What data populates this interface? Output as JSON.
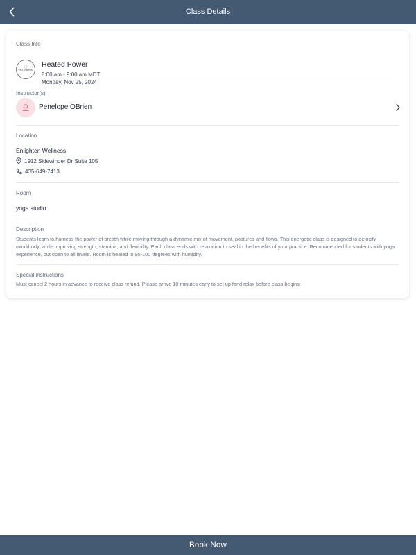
{
  "header": {
    "title": "Class Details",
    "back_icon": "chevron-left-icon"
  },
  "class_info": {
    "label": "Class Info",
    "logo_text": "ENLIGHTEN",
    "name": "Heated Power",
    "time": "8:00 am - 9:00 am MDT",
    "date": "Monday, Nov 25, 2024"
  },
  "instructors": {
    "label": "Instructor(s)",
    "name": "Penelope OBrien",
    "avatar_icon": "person-outline-icon"
  },
  "location": {
    "label": "Location",
    "name": "Enlighten Wellness",
    "address": "1912 Sidewinder Dr Suite 105",
    "phone": "435-649-7413"
  },
  "room": {
    "label": "Room",
    "value": "yoga studio"
  },
  "description": {
    "label": "Description",
    "text": "Students learn to harness the power of breath while moving through a dynamic mix of movement, postures and flows. This energetic class is designed to detoxify mind/body, while improving strength, stamina, and flexibility. Each class ends with relaxation to seal in the benefits of your practice. Recommended for students with yoga experience, but open to all levels. Room is heated to 95-100 degrees with humidity."
  },
  "special_instructions": {
    "label": "Special instructions",
    "text": "Must cancel 2 hours in advance to receive class refund.  Please arrive 10 minutes early to set up fand relax before class begins."
  },
  "footer": {
    "book_label": "Book Now"
  },
  "colors": {
    "header_bg": "#445a73",
    "footer_bg": "#445a73",
    "avatar_bg": "#f8dfe3",
    "avatar_accent": "#d9788a"
  }
}
